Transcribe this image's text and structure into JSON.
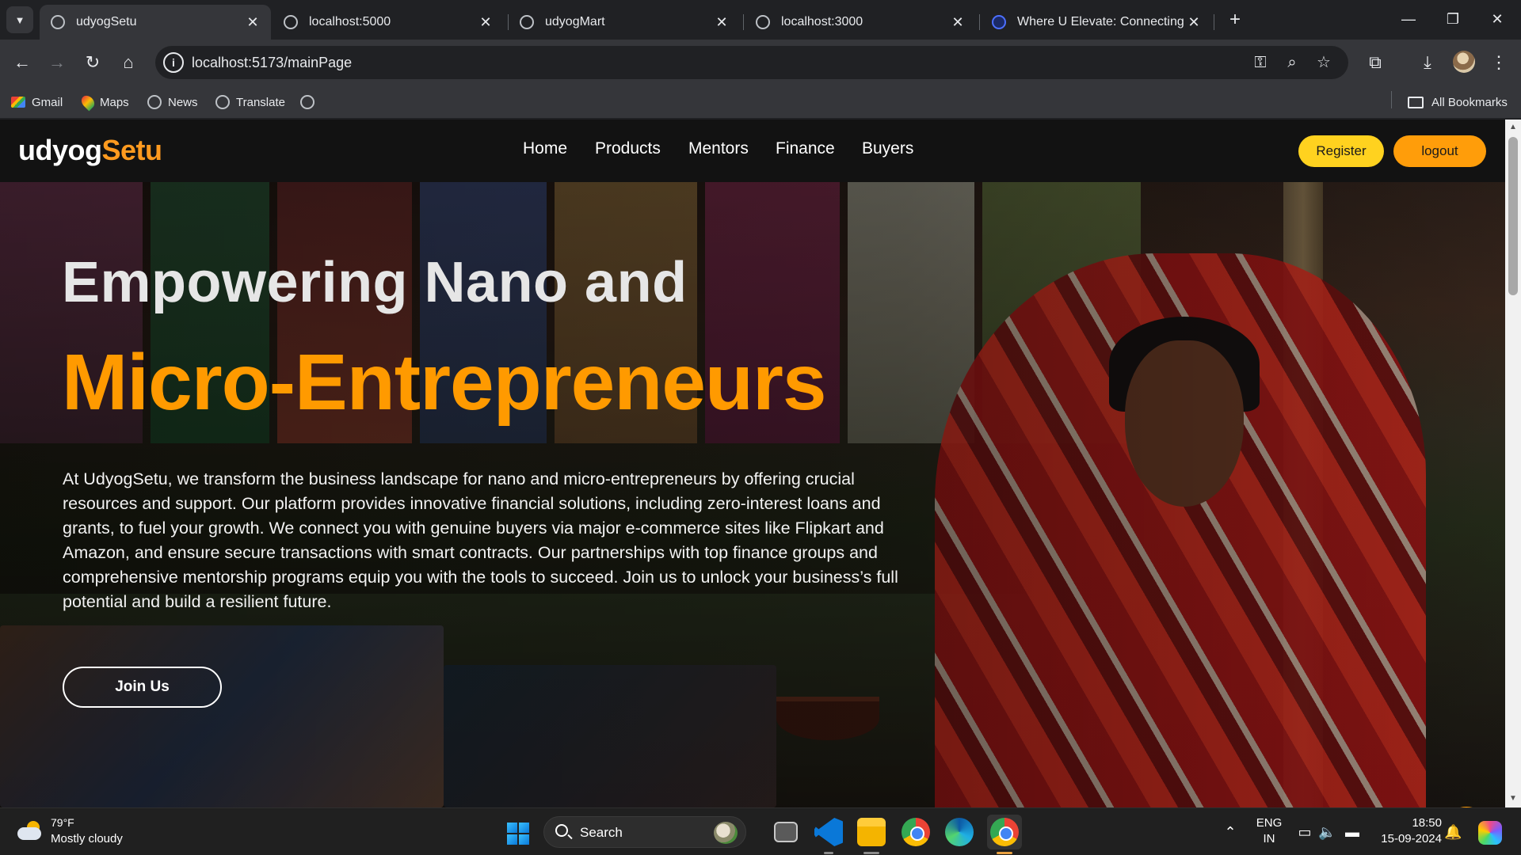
{
  "browser": {
    "tabs": [
      {
        "title": "udyogSetu",
        "active": true
      },
      {
        "title": "localhost:5000",
        "active": false
      },
      {
        "title": "udyogMart",
        "active": false
      },
      {
        "title": "localhost:3000",
        "active": false
      },
      {
        "title": "Where U Elevate: Connecting n",
        "active": false
      }
    ],
    "url": "localhost:5173/mainPage",
    "bookmarks": [
      "Gmail",
      "Maps",
      "News",
      "Translate"
    ],
    "all_bookmarks": "All Bookmarks"
  },
  "site": {
    "logo_part1": "udyog",
    "logo_part2": "Setu",
    "nav": [
      "Home",
      "Products",
      "Mentors",
      "Finance",
      "Buyers"
    ],
    "register": "Register",
    "logout": "logout"
  },
  "hero": {
    "line1": "Empowering Nano and",
    "line2": "Micro-Entrepreneurs",
    "description": "At UdyogSetu, we transform the business landscape for nano and micro-entrepreneurs by offering crucial resources and support. Our platform provides innovative financial solutions, including zero-interest loans and grants, to fuel your growth. We connect you with genuine buyers via major e-commerce sites like Flipkart and Amazon, and ensure secure transactions with smart contracts. Our partnerships with top finance groups and comprehensive mentorship programs equip you with the tools to succeed. Join us to unlock your business’s full potential and build a resilient future.",
    "cta": "Join Us"
  },
  "taskbar": {
    "temperature": "79°F",
    "condition": "Mostly cloudy",
    "search": "Search",
    "lang1": "ENG",
    "lang2": "IN",
    "time": "18:50",
    "date": "15-09-2024"
  },
  "colors": {
    "accent_orange": "#ff9a00",
    "register_yellow": "#ffd21f",
    "logout_orange": "#ff9d0a",
    "nav_bg": "#121212"
  }
}
